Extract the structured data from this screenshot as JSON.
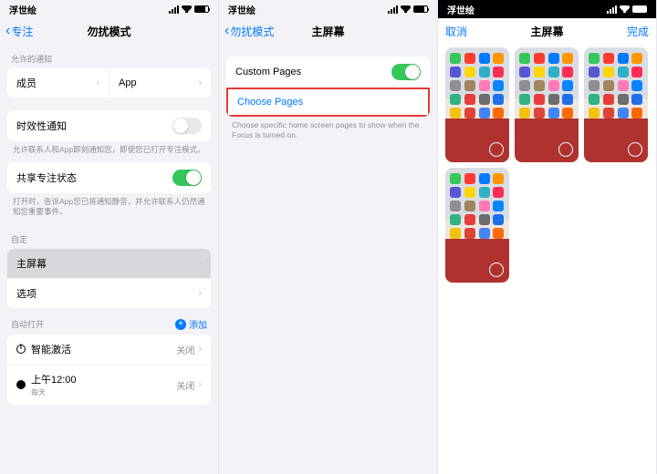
{
  "status": {
    "left_label": "浮世绘"
  },
  "pane1": {
    "back": "专注",
    "title": "勿扰模式",
    "sec_allowed": "允许的通知",
    "people": "成员",
    "apps": "App",
    "time_sensitive": "时效性通知",
    "time_note": "允许联系人和App即刻通知您，即使您已打开专注模式。",
    "share_state": "共享专注状态",
    "share_note": "打开时，告诉App您已将通知静音，并允许联系人仍然通知您重要事件。",
    "sec_custom": "自定",
    "home_screen": "主屏幕",
    "options": "选项",
    "sec_auto": "自动打开",
    "add": "添加",
    "smart": "智能激活",
    "smart_val": "关闭",
    "sched_time": "上午12:00",
    "sched_sub": "每天",
    "sched_val": "关闭"
  },
  "pane2": {
    "back": "勿扰模式",
    "title": "主屏幕",
    "custom_pages": "Custom Pages",
    "choose_pages": "Choose Pages",
    "choose_note": "Choose specific home screen pages to show when the Focus is turned on."
  },
  "pane3": {
    "cancel": "取消",
    "title": "主屏幕",
    "done": "完成"
  },
  "app_colors": [
    "#34c759",
    "#ff3b30",
    "#007aff",
    "#ff9500",
    "#5856d6",
    "#ffd60a",
    "#30b0c7",
    "#ff2d55",
    "#8e8e93",
    "#a2845e",
    "#ff7ab7",
    "#0a84ff",
    "#2fb380",
    "#e73c3c",
    "#6d6d6d",
    "#1f6feb",
    "#f4c20d",
    "#db4437",
    "#4285f4",
    "#ff6a00"
  ]
}
